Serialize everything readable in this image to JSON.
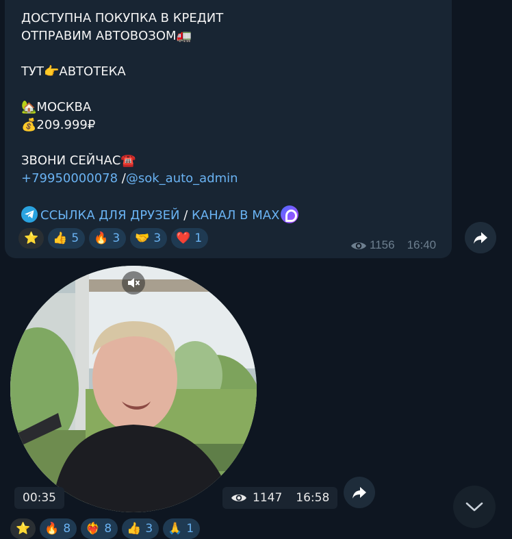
{
  "post1": {
    "lines": {
      "credit": "ДОСТУПНА ПОКУПКА В КРЕДИТ",
      "ship": "ОТПРАВИМ АВТОВОЗОМ",
      "here_prefix": "ТУТ",
      "here_suffix": "АВТОТЕКА",
      "city": "МОСКВА",
      "price": "209.999₽",
      "call": "ЗВОНИ СЕЙЧАС",
      "phone": "+79950000078",
      "separator": " /",
      "handle": "@sok_auto_admin",
      "friends_link": "ССЫЛКА ДЛЯ ДРУЗЕЙ",
      "slash": " / ",
      "max_link": "КАНАЛ В MAX"
    },
    "emojis": {
      "truck": "🚛",
      "point": "👉",
      "house": "🏡",
      "money": "💰",
      "phone": "☎️"
    },
    "reactions": [
      {
        "icon": "⭐",
        "count": ""
      },
      {
        "icon": "👍",
        "count": "5"
      },
      {
        "icon": "🔥",
        "count": "3"
      },
      {
        "icon": "🤝",
        "count": "3"
      },
      {
        "icon": "❤️",
        "count": "1"
      }
    ],
    "views": "1156",
    "time": "16:40"
  },
  "post2": {
    "duration": "00:35",
    "views": "1147",
    "time": "16:58",
    "reactions": [
      {
        "icon": "⭐",
        "count": ""
      },
      {
        "icon": "🔥",
        "count": "8"
      },
      {
        "icon": "❤️‍🔥",
        "count": "8"
      },
      {
        "icon": "👍",
        "count": "3"
      },
      {
        "icon": "🙏",
        "count": "1"
      }
    ]
  },
  "icons": {
    "share": "share-arrow-icon",
    "eye": "eye-icon",
    "mute": "speaker-muted-icon",
    "scroll": "chevron-down-icon"
  },
  "colors": {
    "background": "#0e1621",
    "bubble": "#182533",
    "link": "#6ab3f3",
    "reaction_bg": "#1f3a52",
    "meta": "#6d7f8f"
  }
}
